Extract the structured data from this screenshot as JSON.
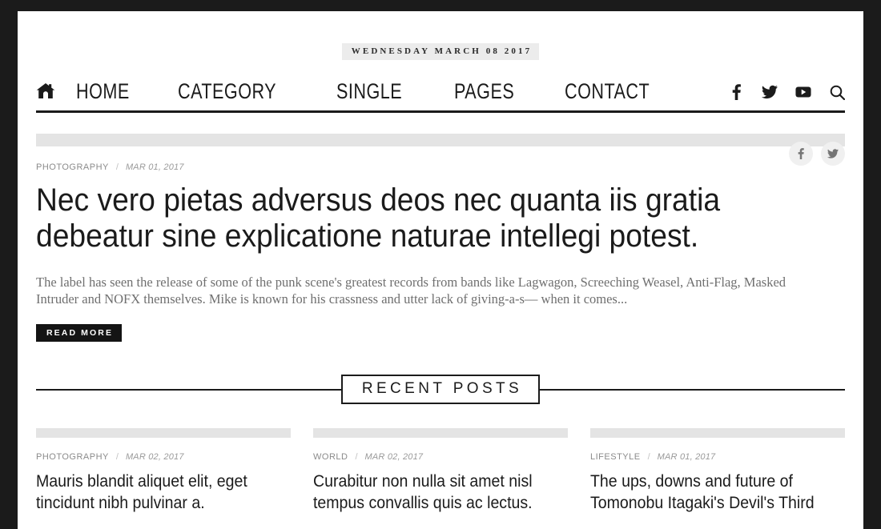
{
  "topbar": {
    "date": "WEDNESDAY MARCH 08 2017"
  },
  "nav": {
    "home_icon": "home-icon",
    "items": [
      {
        "label": "HOME"
      },
      {
        "label": "CATEGORY"
      },
      {
        "label": "SINGLE"
      },
      {
        "label": "PAGES"
      },
      {
        "label": "CONTACT"
      }
    ],
    "social": [
      {
        "name": "facebook-icon"
      },
      {
        "name": "twitter-icon"
      },
      {
        "name": "youtube-icon"
      },
      {
        "name": "search-icon"
      }
    ]
  },
  "hero": {
    "category": "PHOTOGRAPHY",
    "separator": "/",
    "date": "MAR 01, 2017",
    "title": "Nec vero pietas adversus deos nec quanta iis gratia debeatur sine explicatione naturae intellegi potest.",
    "excerpt": "The label has seen the release of some of the punk scene's greatest records from bands like Lagwagon, Screeching Weasel, Anti-Flag, Masked Intruder and NOFX themselves. Mike is known for his crassness and utter lack of giving-a-s— when it comes...",
    "read_more": "READ MORE",
    "share": [
      {
        "name": "facebook-share-icon"
      },
      {
        "name": "twitter-share-icon"
      }
    ]
  },
  "recent": {
    "section_title": "RECENT POSTS",
    "posts": [
      {
        "category": "PHOTOGRAPHY",
        "separator": "/",
        "date": "MAR 02, 2017",
        "title": "Mauris blandit aliquet elit, eget tincidunt nibh pulvinar a."
      },
      {
        "category": "WORLD",
        "separator": "/",
        "date": "MAR 02, 2017",
        "title": "Curabitur non nulla sit amet nisl tempus convallis quis ac lectus."
      },
      {
        "category": "LIFESTYLE",
        "separator": "/",
        "date": "MAR 01, 2017",
        "title": "The ups, downs and future of Tomonobu Itagaki's Devil's Third"
      }
    ]
  },
  "colors": {
    "frame": "#1b1b1b",
    "page": "#ffffff",
    "text": "#1b1b1b",
    "muted": "#8b8b8b",
    "placeholder": "#e4e4e4",
    "accent": "#141414"
  }
}
